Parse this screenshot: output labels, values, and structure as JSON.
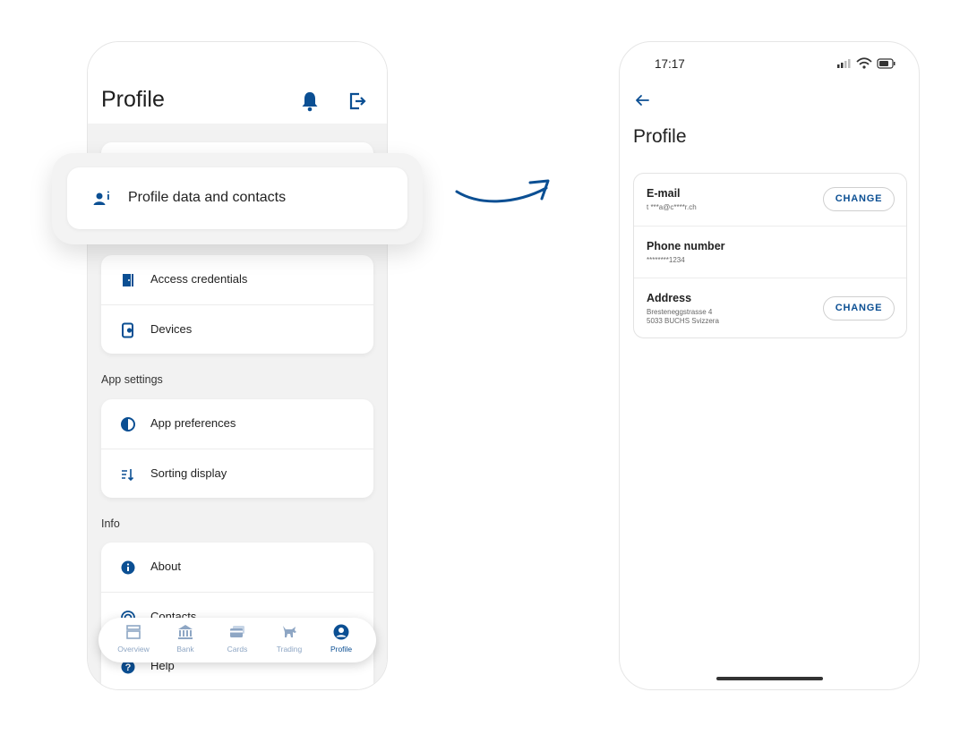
{
  "left_screen": {
    "title": "Profile",
    "highlighted_item": "Profile data and contacts",
    "security_items": [
      "Access credentials",
      "Devices"
    ],
    "app_settings_label": "App settings",
    "app_settings_items": [
      "App preferences",
      "Sorting display"
    ],
    "info_label": "Info",
    "info_items": [
      "About",
      "Contacts",
      "Help"
    ],
    "nav": [
      {
        "label": "Overview",
        "icon": "overview-icon"
      },
      {
        "label": "Bank",
        "icon": "bank-icon"
      },
      {
        "label": "Cards",
        "icon": "cards-icon"
      },
      {
        "label": "Trading",
        "icon": "trading-bull-icon"
      },
      {
        "label": "Profile",
        "icon": "profile-icon",
        "active": true
      }
    ],
    "accent_color": "#0b4f93"
  },
  "right_screen": {
    "time": "17:17",
    "title": "Profile",
    "fields": [
      {
        "label": "E-mail",
        "value": "t ***a@c****r.ch",
        "action": "CHANGE"
      },
      {
        "label": "Phone number",
        "value": "********1234"
      },
      {
        "label": "Address",
        "value_line1": "Bresteneggstrasse 4",
        "value_line2": "5033 BUCHS Svizzera",
        "action": "CHANGE"
      }
    ]
  }
}
